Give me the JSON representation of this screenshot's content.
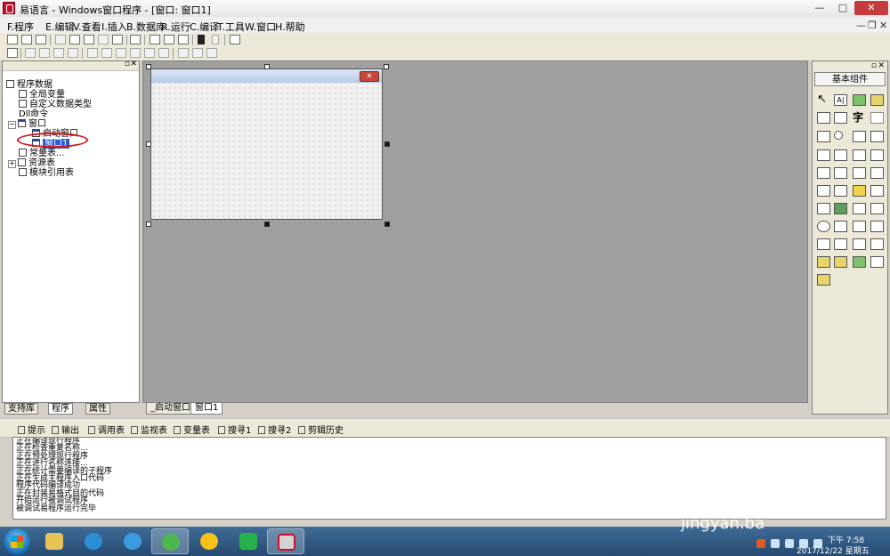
{
  "window": {
    "title": "易语言 - Windows窗口程序 - [窗口: 窗口1]",
    "controls": {
      "minimize": "—",
      "maximize": "□",
      "close": "✕"
    }
  },
  "menu": {
    "items": [
      "F.程序",
      "E.编辑",
      "V.查看",
      "I.插入",
      "B.数据库",
      "R.运行",
      "C.编译",
      "T.工具",
      "W.窗口",
      "H.帮助"
    ],
    "doc_controls": [
      "—",
      "❐",
      "✕"
    ]
  },
  "left_panel": {
    "tree": {
      "root": "程序数据",
      "global_vars": "全局变量",
      "custom_types": "自定义数据类型",
      "dll": "Dll命令",
      "windows": "窗口",
      "startup_window": "启动窗口",
      "window1": "窗口1",
      "constants": "常量表...",
      "resources": "资源表",
      "module_refs": "模块引用表"
    },
    "tabs": [
      "支持库",
      "程序",
      "属性"
    ]
  },
  "designer": {
    "tabs": [
      "_启动窗口",
      "窗口1"
    ],
    "form_close_glyph": "✕"
  },
  "right_panel": {
    "title": "基本组件",
    "first_row_text": [
      "A|",
      "字"
    ]
  },
  "output": {
    "tabs": [
      "提示",
      "输出",
      "调用表",
      "监视表",
      "变量表",
      "搜寻1",
      "搜寻2",
      "剪辑历史"
    ],
    "lines": [
      "正在编译现行程序",
      "正在检查重复名称...",
      "正在预处理现行程序",
      "正在进行名称连接...",
      "正在统计需要编译的子程序",
      "正在生成主程序入口代码",
      "程序代码编译成功",
      "正在封装易格式目的代码",
      "开始运行被调试程序",
      "被调试易程序运行完毕"
    ]
  },
  "taskbar": {
    "time": "下午 7:58",
    "date": "2017/12/22 星期五",
    "watermark": "jingyan.ba"
  },
  "colors": {
    "selection": "#2a5bd6",
    "annotation_circle": "#d3141b",
    "designer_bg": "#a0a0a0",
    "taskbar": "#2f5a84"
  }
}
